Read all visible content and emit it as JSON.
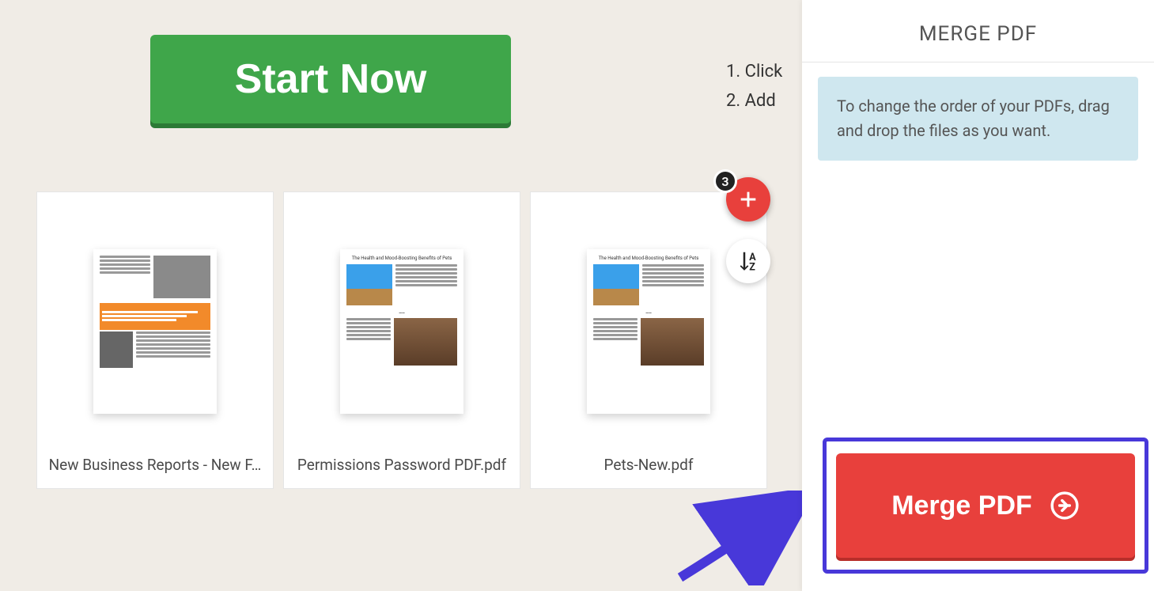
{
  "main": {
    "start_button": "Start Now",
    "instructions": [
      "1. Click",
      "2. Add"
    ],
    "add_badge_count": "3"
  },
  "files": [
    {
      "name": "New Business Reports - New F…",
      "doc_title": ""
    },
    {
      "name": "Permissions Password PDF.pdf",
      "doc_title": "The Health and Mood-Boosting Benefits of Pets"
    },
    {
      "name": "Pets-New.pdf",
      "doc_title": "The Health and Mood-Boosting Benefits of Pets"
    }
  ],
  "panel": {
    "title": "MERGE PDF",
    "info_text": "To change the order of your PDFs, drag and drop the files as you want.",
    "merge_button": "Merge PDF"
  }
}
